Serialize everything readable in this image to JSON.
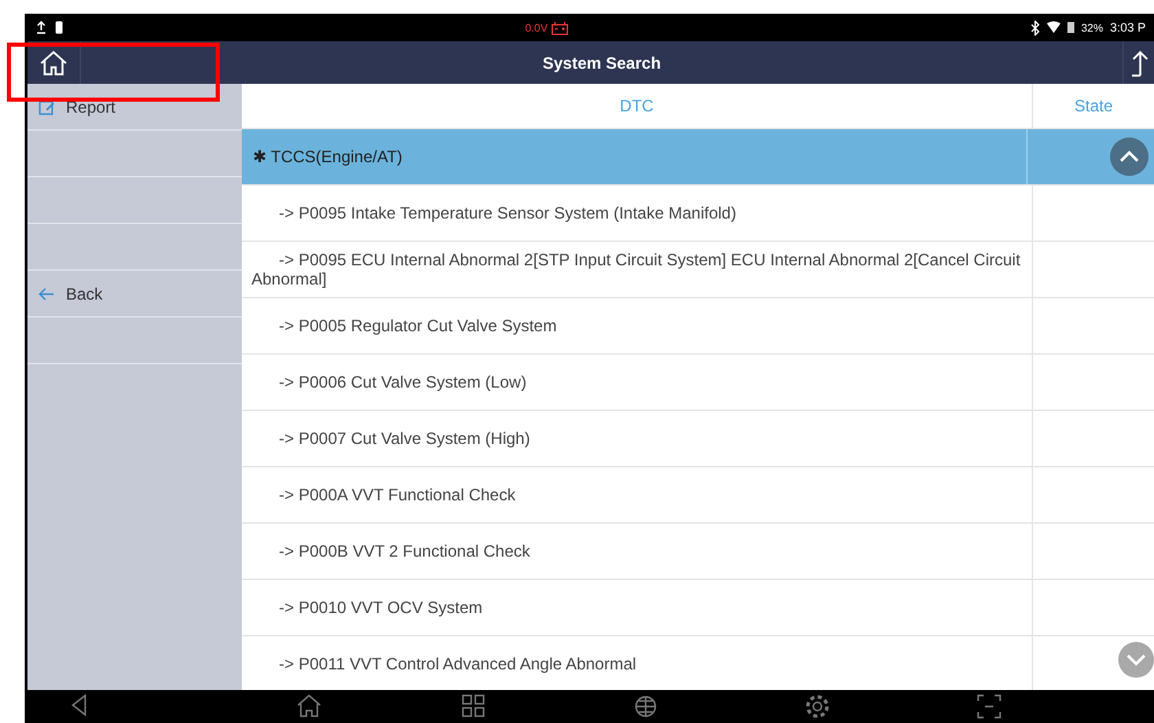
{
  "status_bar": {
    "voltage": "0.0V",
    "battery": "32%",
    "time": "3:03 P"
  },
  "title_bar": {
    "title": "System Search"
  },
  "sidebar": {
    "items": [
      {
        "kind": "report",
        "label": "Report"
      },
      {
        "kind": "empty"
      },
      {
        "kind": "empty"
      },
      {
        "kind": "empty"
      },
      {
        "kind": "back",
        "label": "Back"
      },
      {
        "kind": "empty"
      }
    ]
  },
  "table": {
    "columns": [
      "DTC",
      "State"
    ],
    "group": {
      "label": "✱ TCCS(Engine/AT)",
      "expanded": true
    },
    "rows": [
      {
        "dtc": "->  P0095 Intake Temperature Sensor System (Intake Manifold)"
      },
      {
        "dtc": "->  P0095 ECU Internal Abnormal 2[STP Input Circuit System] ECU Internal Abnormal 2[Cancel Circuit Abnormal]"
      },
      {
        "dtc": "->  P0005 Regulator Cut Valve System"
      },
      {
        "dtc": "->  P0006 Cut Valve System (Low)"
      },
      {
        "dtc": "->  P0007 Cut Valve System (High)"
      },
      {
        "dtc": "->  P000A VVT Functional Check"
      },
      {
        "dtc": "->  P000B VVT 2 Functional Check"
      },
      {
        "dtc": "->  P0010 VVT OCV System"
      },
      {
        "dtc": "->  P0011 VVT Control Advanced Angle Abnormal"
      }
    ]
  }
}
